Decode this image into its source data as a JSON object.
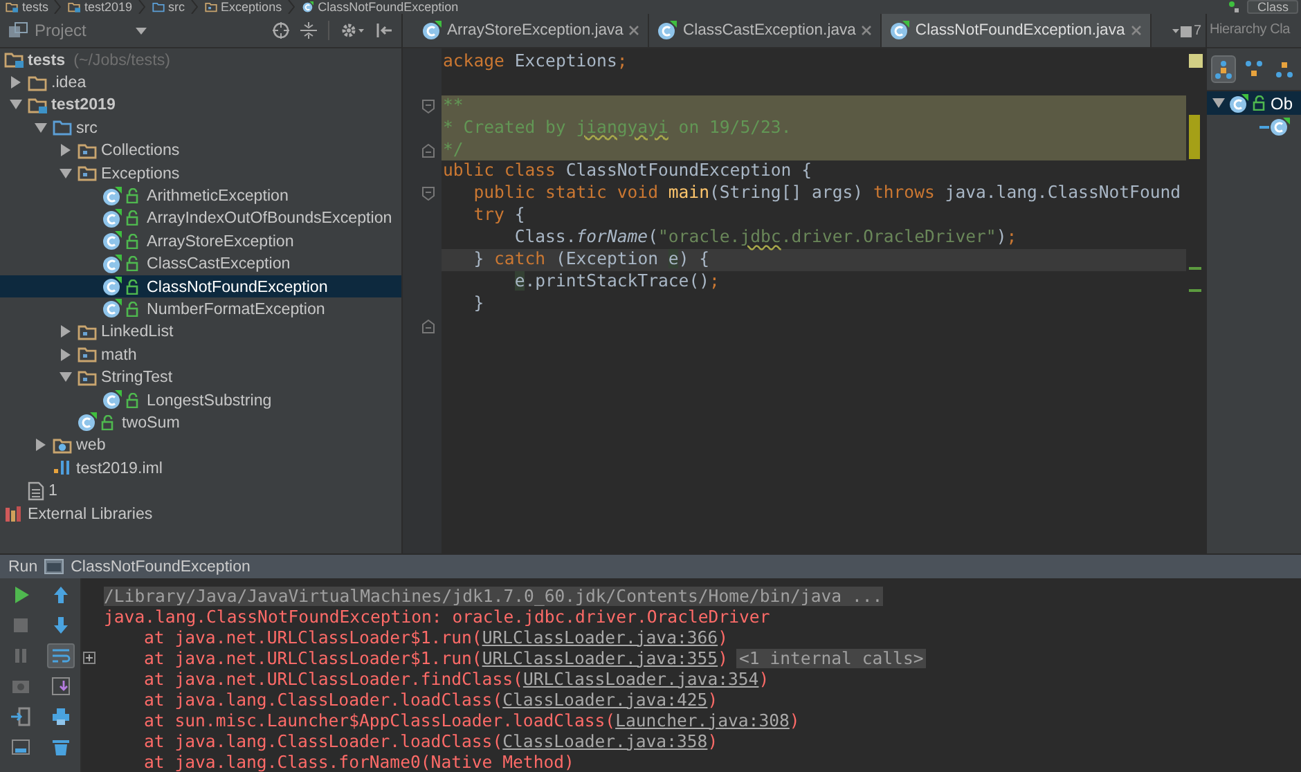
{
  "breadcrumb": {
    "items": [
      {
        "label": "tests",
        "kind": "module"
      },
      {
        "label": "test2019",
        "kind": "module"
      },
      {
        "label": "src",
        "kind": "source"
      },
      {
        "label": "Exceptions",
        "kind": "package"
      },
      {
        "label": "ClassNotFoundException",
        "kind": "class"
      }
    ],
    "run_config": "Class"
  },
  "project_panel": {
    "title": "Project",
    "tree": [
      {
        "label": "tests",
        "detail": "(~/Jobs/tests)",
        "kind": "module",
        "selected": false,
        "children": [
          {
            "label": ".idea",
            "kind": "folder",
            "expanded": false,
            "selected": false
          },
          {
            "label": "test2019",
            "kind": "module",
            "expanded": true,
            "selected": false,
            "children": [
              {
                "label": "src",
                "kind": "source",
                "expanded": true,
                "selected": false,
                "children": [
                  {
                    "label": "Collections",
                    "kind": "package",
                    "expanded": false,
                    "selected": false
                  },
                  {
                    "label": "Exceptions",
                    "kind": "package",
                    "expanded": true,
                    "selected": false,
                    "children": [
                      {
                        "label": "ArithmeticException",
                        "kind": "class",
                        "selected": false
                      },
                      {
                        "label": "ArrayIndexOutOfBoundsException",
                        "kind": "class",
                        "selected": false
                      },
                      {
                        "label": "ArrayStoreException",
                        "kind": "class",
                        "selected": false
                      },
                      {
                        "label": "ClassCastException",
                        "kind": "class",
                        "selected": false
                      },
                      {
                        "label": "ClassNotFoundException",
                        "kind": "class",
                        "selected": true
                      },
                      {
                        "label": "NumberFormatException",
                        "kind": "class",
                        "selected": false
                      }
                    ]
                  },
                  {
                    "label": "LinkedList",
                    "kind": "package",
                    "expanded": false,
                    "selected": false
                  },
                  {
                    "label": "math",
                    "kind": "package",
                    "expanded": false,
                    "selected": false
                  },
                  {
                    "label": "StringTest",
                    "kind": "package",
                    "expanded": true,
                    "selected": false,
                    "children": [
                      {
                        "label": "LongestSubstring",
                        "kind": "class",
                        "selected": false
                      }
                    ]
                  },
                  {
                    "label": "twoSum",
                    "kind": "class",
                    "selected": false
                  }
                ]
              },
              {
                "label": "web",
                "kind": "web",
                "expanded": false,
                "selected": false
              },
              {
                "label": "test2019.iml",
                "kind": "iml",
                "selected": false
              }
            ]
          },
          {
            "label": "1",
            "kind": "file",
            "selected": false
          }
        ]
      },
      {
        "label": "External Libraries",
        "kind": "libraries",
        "selected": false
      }
    ]
  },
  "editor": {
    "tabs": [
      {
        "label": "ArrayStoreException.java",
        "selected": false
      },
      {
        "label": "ClassCastException.java",
        "selected": false
      },
      {
        "label": "ClassNotFoundException.java",
        "selected": true
      }
    ],
    "overflow_count": "7",
    "lines": [
      {
        "kind": "code",
        "highlighted": false,
        "current": false,
        "tokens": [
          {
            "text": "ackage",
            "kind": "keyword"
          },
          {
            "text": " Exceptions",
            "kind": "plain"
          },
          {
            "text": ";",
            "kind": "keyword"
          }
        ]
      },
      {
        "kind": "blank"
      },
      {
        "kind": "code",
        "highlighted": true,
        "current": false,
        "fold_start": true,
        "tokens": [
          {
            "text": "**",
            "kind": "comment"
          }
        ]
      },
      {
        "kind": "code",
        "highlighted": true,
        "current": false,
        "tokens": [
          {
            "text": "* Created by ",
            "kind": "comment"
          },
          {
            "text": "jiangyayi",
            "kind": "comment_typo"
          },
          {
            "text": " on 19/5/23.",
            "kind": "comment"
          }
        ]
      },
      {
        "kind": "code",
        "highlighted": true,
        "current": false,
        "fold_end": true,
        "tokens": [
          {
            "text": "*/",
            "kind": "comment"
          }
        ]
      },
      {
        "kind": "code",
        "highlighted": false,
        "current": false,
        "tokens": [
          {
            "text": "ublic class",
            "kind": "keyword"
          },
          {
            "text": " ClassNotFoundException {",
            "kind": "plain"
          }
        ]
      },
      {
        "kind": "code",
        "highlighted": false,
        "current": false,
        "fold_start": true,
        "tokens": [
          {
            "text": "   public static void ",
            "kind": "keyword"
          },
          {
            "text": "main",
            "kind": "method_decl"
          },
          {
            "text": "(String[] args) ",
            "kind": "plain"
          },
          {
            "text": "throws",
            "kind": "keyword"
          },
          {
            "text": " java.lang.ClassNotFound",
            "kind": "plain"
          }
        ]
      },
      {
        "kind": "code",
        "highlighted": false,
        "current": false,
        "tokens": [
          {
            "text": "   try",
            "kind": "keyword"
          },
          {
            "text": " {",
            "kind": "plain"
          }
        ]
      },
      {
        "kind": "code",
        "highlighted": false,
        "current": false,
        "tokens": [
          {
            "text": "       Class.",
            "kind": "plain"
          },
          {
            "text": "forName",
            "kind": "static_call"
          },
          {
            "text": "(",
            "kind": "plain"
          },
          {
            "text": "\"oracle.",
            "kind": "string"
          },
          {
            "text": "jdbc",
            "kind": "string_typo"
          },
          {
            "text": ".driver.OracleDriver\"",
            "kind": "string"
          },
          {
            "text": ")",
            "kind": "plain"
          },
          {
            "text": ";",
            "kind": "keyword"
          }
        ]
      },
      {
        "kind": "code",
        "highlighted": false,
        "current": true,
        "tokens": [
          {
            "text": "   } ",
            "kind": "plain"
          },
          {
            "text": "catch",
            "kind": "keyword"
          },
          {
            "text": " (Exception ",
            "kind": "plain"
          },
          {
            "text": "e",
            "kind": "usage"
          },
          {
            "text": ") {",
            "kind": "plain"
          }
        ]
      },
      {
        "kind": "code",
        "highlighted": false,
        "current": false,
        "tokens": [
          {
            "text": "       e",
            "kind": "usage"
          },
          {
            "text": ".printStackTrace()",
            "kind": "plain"
          },
          {
            "text": ";",
            "kind": "keyword"
          }
        ]
      },
      {
        "kind": "code",
        "highlighted": false,
        "current": false,
        "tokens": [
          {
            "text": "   }",
            "kind": "plain"
          }
        ]
      },
      {
        "kind": "blank",
        "fold_end": true
      }
    ]
  },
  "hierarchy_panel": {
    "title": "Hierarchy Cla",
    "tools": [
      {
        "kind": "hierarchy",
        "selected": true
      },
      {
        "kind": "supertypes",
        "selected": false
      },
      {
        "kind": "subtypes",
        "selected": false
      }
    ],
    "tree": [
      {
        "label": "Ob",
        "expanded": true,
        "selected": true,
        "children": [
          {
            "kind": "subclass"
          }
        ]
      }
    ]
  },
  "run_panel": {
    "title": "Run",
    "config": "ClassNotFoundException",
    "tools_left": [
      {
        "kind": "rerun",
        "disabled": false
      },
      {
        "kind": "stop",
        "disabled": true
      },
      {
        "kind": "pause",
        "disabled": true
      },
      {
        "kind": "dump",
        "disabled": true
      },
      {
        "kind": "exit",
        "disabled": false
      },
      {
        "kind": "layout",
        "disabled": false
      }
    ],
    "tools_right": [
      {
        "kind": "up",
        "selected": false
      },
      {
        "kind": "down",
        "selected": false
      },
      {
        "kind": "wrap",
        "selected": true
      },
      {
        "kind": "scroll",
        "selected": false
      },
      {
        "kind": "print",
        "selected": false
      },
      {
        "kind": "trash",
        "selected": false
      }
    ],
    "console": [
      {
        "kind": "command",
        "foldable": false,
        "parts": [
          {
            "text": "/Library/Java/JavaVirtualMachines/jdk1.7.0_60.jdk/Contents/Home/bin/java ...",
            "kind": "text"
          }
        ]
      },
      {
        "kind": "error",
        "foldable": false,
        "parts": [
          {
            "text": "java.lang.ClassNotFoundException: oracle.jdbc.driver.OracleDriver",
            "kind": "text"
          }
        ]
      },
      {
        "kind": "frame",
        "foldable": false,
        "parts": [
          {
            "text": "at java.net.URLClassLoader$1.run(",
            "kind": "text"
          },
          {
            "text": "URLClassLoader.java:366",
            "kind": "link"
          },
          {
            "text": ")",
            "kind": "text"
          }
        ]
      },
      {
        "kind": "frame",
        "foldable": true,
        "parts": [
          {
            "text": "at java.net.URLClassLoader$1.run(",
            "kind": "text"
          },
          {
            "text": "URLClassLoader.java:355",
            "kind": "link"
          },
          {
            "text": ")",
            "kind": "text"
          },
          {
            "text": "<1 internal calls>",
            "kind": "note"
          }
        ]
      },
      {
        "kind": "frame",
        "foldable": false,
        "parts": [
          {
            "text": "at java.net.URLClassLoader.findClass(",
            "kind": "text"
          },
          {
            "text": "URLClassLoader.java:354",
            "kind": "link"
          },
          {
            "text": ")",
            "kind": "text"
          }
        ]
      },
      {
        "kind": "frame",
        "foldable": false,
        "parts": [
          {
            "text": "at java.lang.ClassLoader.loadClass(",
            "kind": "text"
          },
          {
            "text": "ClassLoader.java:425",
            "kind": "link"
          },
          {
            "text": ")",
            "kind": "text"
          }
        ]
      },
      {
        "kind": "frame",
        "foldable": false,
        "parts": [
          {
            "text": "at sun.misc.Launcher$AppClassLoader.loadClass(",
            "kind": "text"
          },
          {
            "text": "Launcher.java:308",
            "kind": "link"
          },
          {
            "text": ")",
            "kind": "text"
          }
        ]
      },
      {
        "kind": "frame",
        "foldable": false,
        "parts": [
          {
            "text": "at java.lang.ClassLoader.loadClass(",
            "kind": "text"
          },
          {
            "text": "ClassLoader.java:358",
            "kind": "link"
          },
          {
            "text": ")",
            "kind": "text"
          }
        ]
      },
      {
        "kind": "frame",
        "foldable": false,
        "parts": [
          {
            "text": "at java.lang.Class.forName0(Native Method)",
            "kind": "text"
          }
        ]
      }
    ]
  }
}
